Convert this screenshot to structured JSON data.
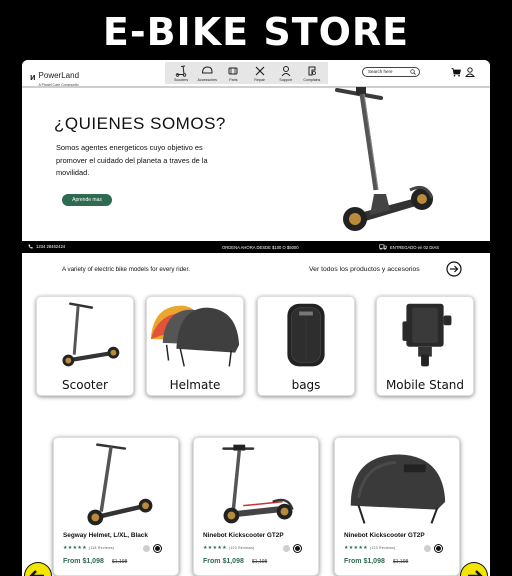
{
  "banner": {
    "title": "E-BIKE STORE"
  },
  "header": {
    "logo_mark": "ᴎ",
    "logo_name": "PowerLand",
    "logo_tagline": "A Planet Care Community",
    "search_placeholder": "Search here",
    "nav": [
      {
        "label": "Scooters",
        "icon": "scooter-icon"
      },
      {
        "label": "Accessories",
        "icon": "helmet-icon"
      },
      {
        "label": "Parts",
        "icon": "parts-icon"
      },
      {
        "label": "Repair",
        "icon": "wrench-icon"
      },
      {
        "label": "Support",
        "icon": "support-icon"
      },
      {
        "label": "Complains",
        "icon": "complain-icon"
      }
    ]
  },
  "hero": {
    "title": "¿QUIENES SOMOS?",
    "text": "Somos agentes energeticos cuyo objetivo es promover el cuidado del planeta a traves de la movilidad.",
    "button": "Aprende mas"
  },
  "promo": {
    "phone": "1234 28462424",
    "offer": "ORDENA AHORA DESDE $100 O $5000",
    "delivery": "ENTREGADO en 02 DIAS"
  },
  "section": {
    "variety": "A variety of electric bike models for every rider.",
    "see_all": "Ver todos los productos y accesorios"
  },
  "categories": [
    {
      "label": "Scooter"
    },
    {
      "label": "Helmate"
    },
    {
      "label": "bags"
    },
    {
      "label": "Mobile Stand"
    }
  ],
  "products": [
    {
      "name": "Segway Helmet, L/XL, Black",
      "reviews": "(118 Reviews)",
      "price": "From $1,098",
      "old_price": "$1,198",
      "stars": 5
    },
    {
      "name": "Ninebot Kickscooter GT2P",
      "reviews": "(120 Reviews)",
      "price": "From $1,098",
      "old_price": "$1,198",
      "stars": 5
    },
    {
      "name": "Ninebot Kickscooter GT2P",
      "reviews": "(120 Reviews)",
      "price": "From $1,098",
      "old_price": "$1,198",
      "stars": 5
    }
  ],
  "colors": {
    "accent": "#2e6b50",
    "carousel": "#f2e600",
    "nav_bg": "#e6e6e6"
  }
}
